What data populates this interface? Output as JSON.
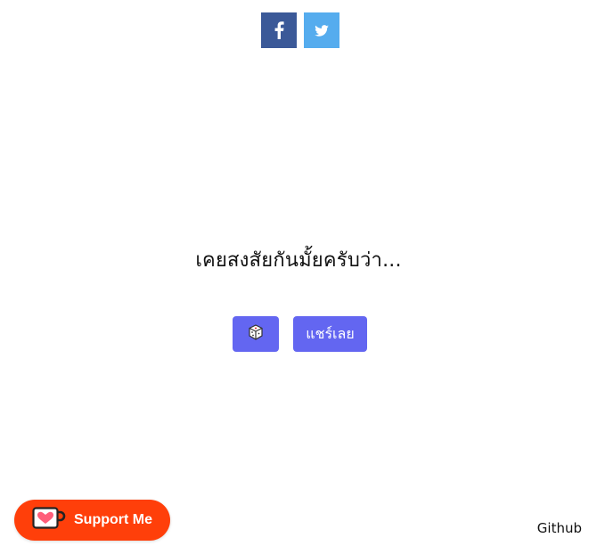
{
  "share": {
    "facebook": {
      "icon": "facebook-icon",
      "color": "#3b5998"
    },
    "twitter": {
      "icon": "twitter-icon",
      "color": "#55acee"
    }
  },
  "main": {
    "question": "เคยสงสัยกันมั้ยครับว่า..."
  },
  "actions": {
    "random": {
      "icon": "dice-icon",
      "color": "#6366f1"
    },
    "share_label": "แชร์เลย"
  },
  "footer": {
    "support_label": "Support Me",
    "support_icon": "kofi-cup-heart-icon",
    "support_color": "#ff3f0a",
    "github_label": "Github"
  }
}
